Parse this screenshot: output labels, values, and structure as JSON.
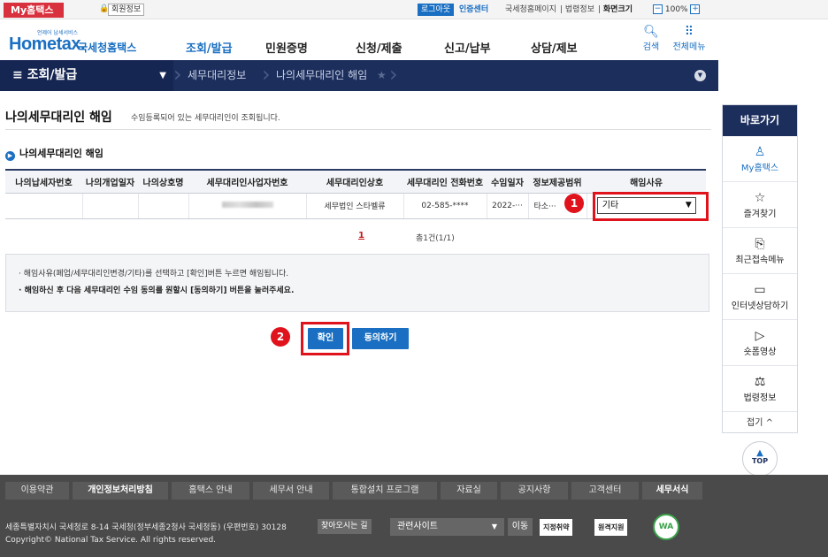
{
  "topbar": {
    "my_hometax": "My홈택스",
    "member_info": "회원정보",
    "logout": "로그아웃",
    "cert_center": "인증센터",
    "links": [
      "국세청홈페이지",
      "법령정보"
    ],
    "screen_size_label": "화면크기",
    "zoom_minus": "−",
    "zoom_value": "100%",
    "zoom_plus": "+"
  },
  "header": {
    "logo_sub": "언제어 납세서비스",
    "logo_main": "Hometax.",
    "logo_kr": "국세청홈택스",
    "menu": [
      "조회/발급",
      "민원증명",
      "신청/제출",
      "신고/납부",
      "상담/제보"
    ],
    "search_label": "검색",
    "all_menu_label": "전체메뉴"
  },
  "subnav": {
    "home_label": "≡  조회/발급",
    "crumbs": [
      "세무대리정보",
      "나의세무대리인 해임"
    ],
    "star": "★"
  },
  "page": {
    "title": "나의세무대리인 해임",
    "description": "수임등록되어 있는 세무대리인이 조회됩니다.",
    "section_title": "나의세무대리인 해임"
  },
  "table": {
    "headers": [
      "나의납세자번호",
      "나의개업일자",
      "나의상호명",
      "세무대리인사업자번호",
      "세무대리인상호",
      "세무대리인 전화번호",
      "수임일자",
      "정보제공범위",
      "해임사유"
    ],
    "row": {
      "taxpayer_no": "",
      "open_date": "",
      "company": "",
      "agent_biz_no": "",
      "agent_name": "세무법인 스타벨류",
      "agent_phone": "02-585-****",
      "date": "2022-···",
      "scope": "타소···",
      "reason_selected": "기타"
    }
  },
  "pager": {
    "current": "1",
    "total": "총1건(1/1)"
  },
  "notes": [
    "해임사유(폐업/세무대리인변경/기타)를 선택하고 [확인]버튼 누르면 해임됩니다.",
    "해임하신 후 다음 세무대리인 수임 동의를 원할시 [동의하기] 버튼을 눌러주세요."
  ],
  "buttons": {
    "confirm": "확인",
    "agree": "동의하기"
  },
  "annotations": {
    "badge1": "1",
    "badge2": "2",
    "highlight_color": "#e0121c"
  },
  "quick": {
    "title": "바로가기",
    "items": [
      {
        "icon": "person-icon",
        "label": "My홈택스"
      },
      {
        "icon": "star-icon",
        "label": "즐겨찾기"
      },
      {
        "icon": "recent-icon",
        "label": "최근접속메뉴"
      },
      {
        "icon": "monitor-icon",
        "label": "인터넷상담하기"
      },
      {
        "icon": "play-icon",
        "label": "숏폼영상"
      },
      {
        "icon": "gavel-icon",
        "label": "법령정보"
      }
    ],
    "close_label": "접기 ^",
    "top_label": "TOP"
  },
  "footer": {
    "links": [
      "이용약관",
      "개인정보처리방침",
      "홈택스 안내",
      "세무서 안내",
      "통합설치 프로그램",
      "자료실",
      "공지사항",
      "고객센터",
      "세무서식"
    ],
    "address": "세종특별자치시 국세청로 8-14 국세청(정부세종2청사 국세청동) (우편번호) 30128",
    "directions": "찾아오시는 길",
    "related_sites": "관련사이트",
    "go": "이동",
    "badges": [
      "지정취약",
      "원격지원"
    ],
    "copyright": "Copyright© National Tax Service. All rights reserved.",
    "wa_mark": "WA"
  },
  "colors": {
    "brand": "#1a6fc2",
    "nav": "#1c2e5c",
    "alert": "#e0121c",
    "footer": "#4a4a4a"
  }
}
